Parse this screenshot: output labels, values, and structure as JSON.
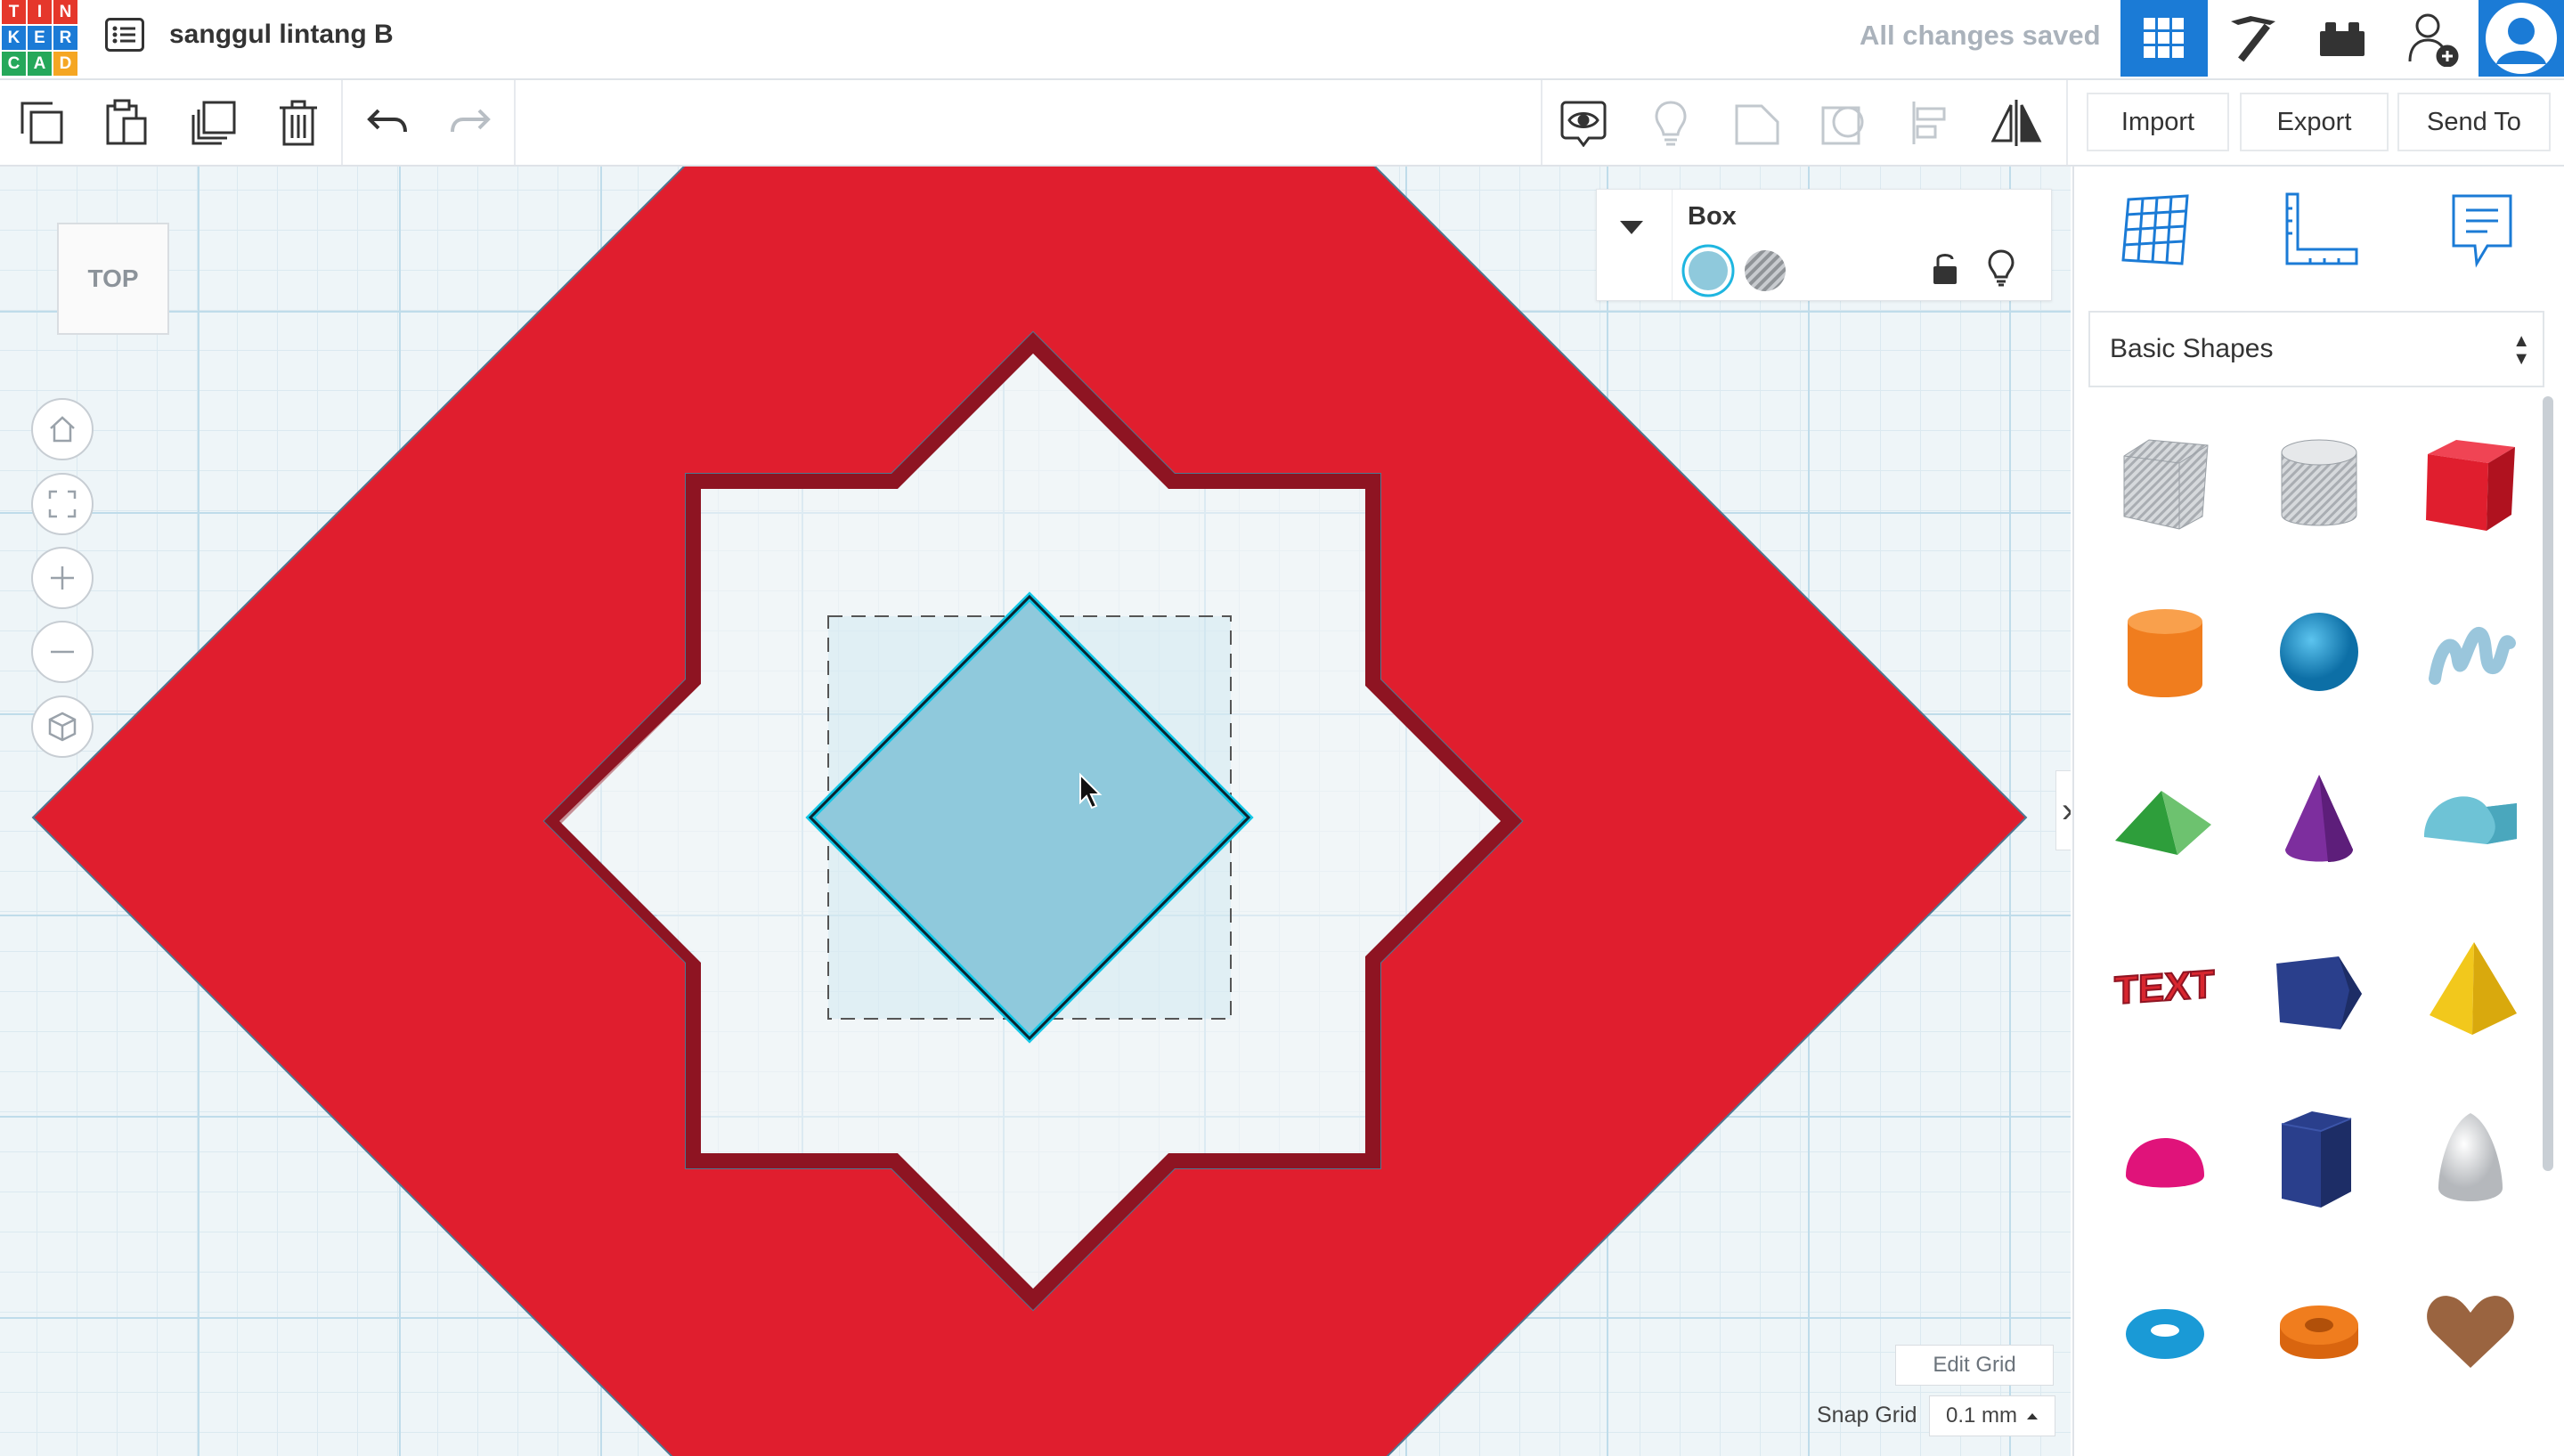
{
  "app": {
    "logo_letters": [
      "T",
      "I",
      "N",
      "K",
      "E",
      "R",
      "C",
      "A",
      "D"
    ],
    "logo_colors": [
      "#e5372b",
      "#e5372b",
      "#e5372b",
      "#1b7bd6",
      "#1b7bd6",
      "#1b7bd6",
      "#25a85a",
      "#25a85a",
      "#f5a623"
    ],
    "design_title": "sanggul lintang B",
    "save_status": "All changes saved",
    "accent": "#1b7bd6"
  },
  "topbar": {
    "icons": [
      "list-icon",
      "grid-view-icon",
      "pickaxe-icon",
      "bricks-icon",
      "add-user-icon",
      "avatar-icon"
    ]
  },
  "toolbar": {
    "tools": [
      "copy-icon",
      "paste-icon",
      "duplicate-icon",
      "trash-icon",
      "undo-icon",
      "redo-icon",
      "show-all-icon",
      "light-bulb-icon",
      "group-icon",
      "ungroup-icon",
      "align-icon",
      "mirror-icon"
    ],
    "import_label": "Import",
    "export_label": "Export",
    "send_to_label": "Send To"
  },
  "workplane": {
    "view_cube_label": "TOP",
    "nav_buttons": [
      "home-view",
      "fit-view",
      "zoom-in",
      "zoom-out",
      "perspective-toggle"
    ],
    "edit_grid_label": "Edit Grid",
    "snap_grid_label": "Snap Grid",
    "snap_grid_value": "0.1 mm",
    "colors": {
      "red_shape": "#e01e2e",
      "red_edge": "#8e1422",
      "selected_box": "#8fc9dc",
      "selection_outline": "#13c7e6"
    }
  },
  "inspector": {
    "title": "Box",
    "solid_color": "#8fc9dc",
    "options": [
      "solid-swatch",
      "hole-swatch",
      "lock-icon",
      "visibility-bulb-icon"
    ]
  },
  "panel": {
    "view_tabs": [
      "workplane-grid-tab",
      "ruler-tab",
      "notes-tab"
    ],
    "category": "Basic Shapes",
    "shapes": [
      {
        "name": "box-hole",
        "color": "#c9ccd1"
      },
      {
        "name": "cylinder-hole",
        "color": "#c9ccd1"
      },
      {
        "name": "box",
        "color": "#e01e2e"
      },
      {
        "name": "cylinder",
        "color": "#f07d1e"
      },
      {
        "name": "sphere",
        "color": "#1a9ad6"
      },
      {
        "name": "scribble",
        "color": "#9ac6dc"
      },
      {
        "name": "roof",
        "color": "#2e9e3b"
      },
      {
        "name": "cone",
        "color": "#7d2e9e"
      },
      {
        "name": "round-roof",
        "color": "#6ec3d6"
      },
      {
        "name": "text",
        "color": "#d9262f"
      },
      {
        "name": "polygon-prism",
        "color": "#2a3f8c"
      },
      {
        "name": "pyramid",
        "color": "#f2c81c"
      },
      {
        "name": "half-sphere",
        "color": "#e0137a"
      },
      {
        "name": "hexagonal-prism",
        "color": "#2a3f8c"
      },
      {
        "name": "paraboloid",
        "color": "#d9dadc"
      },
      {
        "name": "torus",
        "color": "#1a9ad6"
      },
      {
        "name": "tube",
        "color": "#f07d1e"
      },
      {
        "name": "heart",
        "color": "#9a6440"
      }
    ],
    "text_shape_label": "TEXT"
  }
}
